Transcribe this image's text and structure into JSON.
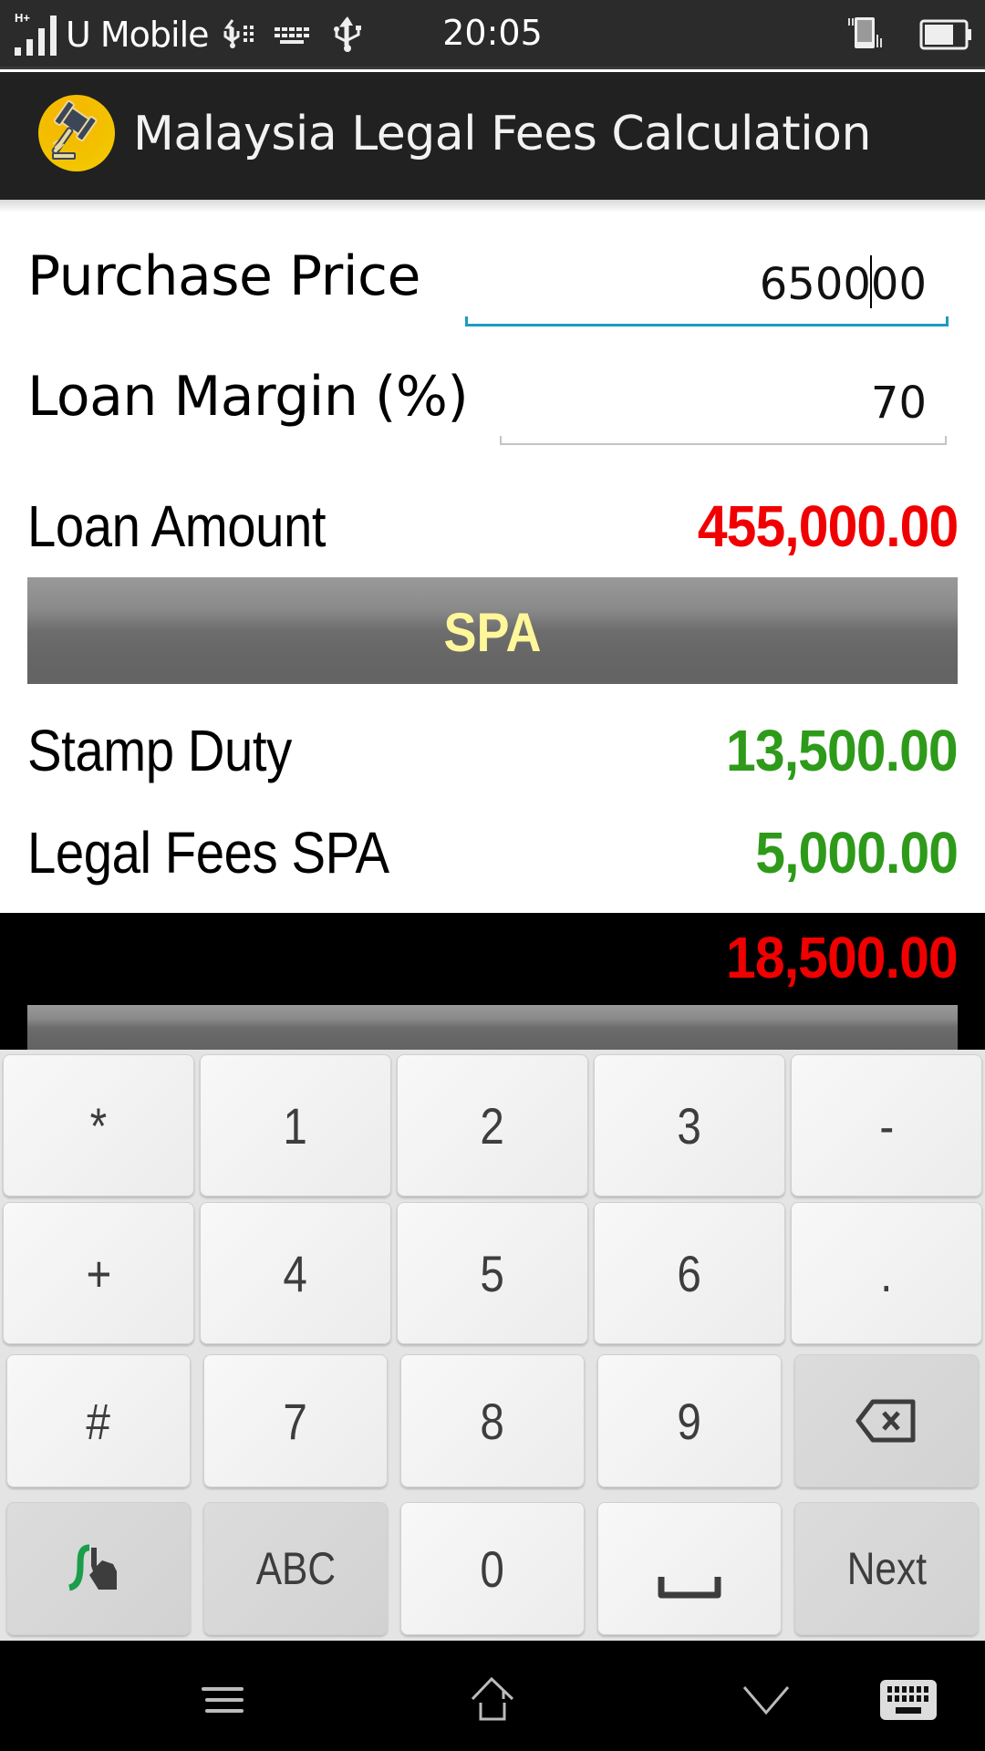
{
  "status_bar": {
    "network_type": "H+",
    "carrier": "U Mobile",
    "time": "20:05",
    "icons": [
      "signal-icon",
      "usb-debug-icon",
      "keyboard-icon",
      "usb-icon",
      "vibrate-icon",
      "battery-icon"
    ]
  },
  "app_bar": {
    "title": "Malaysia Legal Fees Calculation",
    "logo_icon": "gavel-icon"
  },
  "form": {
    "purchase_price": {
      "label": "Purchase Price",
      "value_before_caret": "6500",
      "value_after_caret": "00",
      "value": "650000",
      "focused": true
    },
    "loan_margin": {
      "label": "Loan Margin (%)",
      "value": "70"
    },
    "loan_amount": {
      "label": "Loan Amount",
      "value": "455,000.00"
    }
  },
  "spa_section": {
    "title": "SPA",
    "stamp_duty": {
      "label": "Stamp Duty",
      "value": "13,500.00"
    },
    "legal_fees": {
      "label": "Legal Fees SPA",
      "value": "5,000.00"
    },
    "total": "18,500.00"
  },
  "colors": {
    "accent_focus": "#1a9bc3",
    "value_red": "#f00000",
    "value_green": "#2e9a1a",
    "section_title": "#fff79a",
    "app_bar": "#212121"
  },
  "keyboard": {
    "rows": [
      [
        "*",
        "1",
        "2",
        "3",
        "-"
      ],
      [
        "+",
        "4",
        "5",
        "6",
        "."
      ],
      [
        "#",
        "7",
        "8",
        "9",
        "backspace"
      ],
      [
        "swype",
        "ABC",
        "0",
        "space",
        "Next"
      ]
    ],
    "backspace_icon": "backspace-icon",
    "space_icon": "space-bar-icon",
    "swype_icon": "swype-icon"
  },
  "nav_bar": {
    "buttons": [
      "menu-icon",
      "home-icon",
      "hide-keyboard-icon",
      "keyboard-switch-icon"
    ]
  }
}
